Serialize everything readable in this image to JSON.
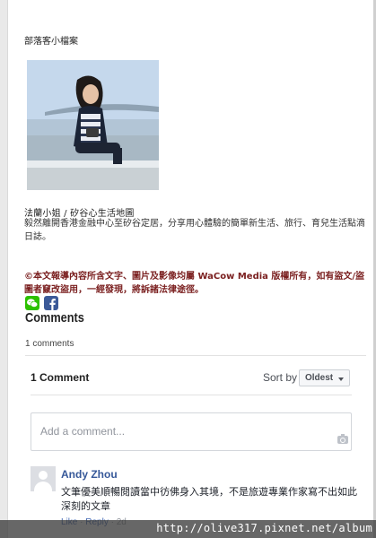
{
  "profile": {
    "heading": "部落客小檔案",
    "photo_icon": "blogger-photo"
  },
  "blog": {
    "title": "法蘭小姐 / 矽谷心生活地圖",
    "description": "毅然離開香港金融中心至矽谷定居，分享用心體驗的簡單新生活、旅行、育兒生活點滴日誌。"
  },
  "copyright": "©本文報導內容所含文字、圖片及影像均屬 WaCow Media 版權所有，如有盜文/盜圖者竄改盜用，一經發現，將訴諸法律途徑。",
  "share": {
    "wechat_icon": "wechat-icon",
    "facebook_icon": "facebook-icon",
    "colors": {
      "wechat": "#2dc100",
      "facebook": "#3b5998"
    }
  },
  "comments": {
    "heading": "Comments",
    "count_label": "1 comments"
  },
  "fb_plugin": {
    "count_label": "1 Comment",
    "sort_label": "Sort by",
    "sort_selected": "Oldest",
    "input_placeholder": "Add a comment...",
    "camera_icon": "camera-icon"
  },
  "comment_list": [
    {
      "author": "Andy Zhou",
      "text": "文筆優美順暢閱讀當中彷佛身入其境，不是旅遊專業作家寫不出如此深刻的文章",
      "like_label": "Like",
      "dot": "·",
      "reply_label": "Reply",
      "time": "2d"
    }
  ],
  "watermark_url": "http://olive317.pixnet.net/album"
}
